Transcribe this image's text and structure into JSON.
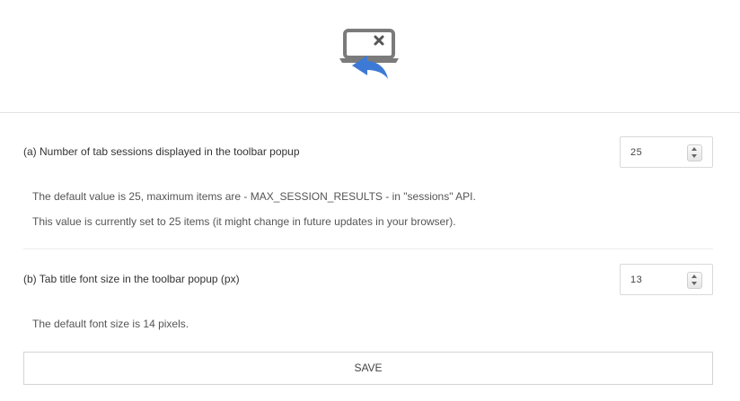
{
  "header": {
    "logo_icon": "tab-sessions-undo-icon",
    "brand_color": "#3d7ad6"
  },
  "options": {
    "a": {
      "label": "(a) Number of tab sessions displayed in the toolbar popup",
      "value": "25",
      "desc_1": "The default value is 25, maximum items are - MAX_SESSION_RESULTS - in \"sessions\" API.",
      "desc_2": "This value is currently set to 25 items (it might change in future updates in your browser)."
    },
    "b": {
      "label": "(b) Tab title font size in the toolbar popup (px)",
      "value": "13",
      "desc_1": "The default font size is 14 pixels."
    }
  },
  "save_label": "SAVE"
}
